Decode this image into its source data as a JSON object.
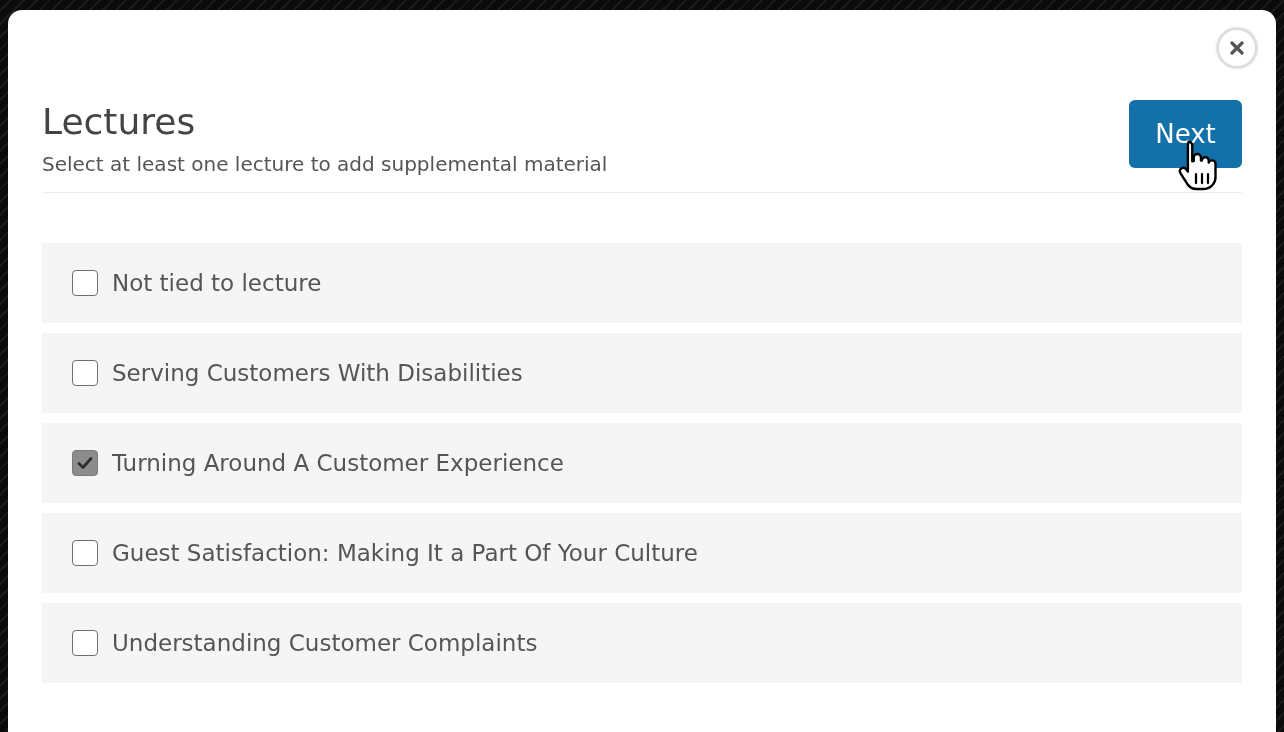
{
  "dialog": {
    "title": "Lectures",
    "subtitle": "Select at least one lecture to add supplemental material",
    "next_button": {
      "label": "Next"
    }
  },
  "lectures": [
    {
      "label": "Not tied to lecture",
      "checked": false
    },
    {
      "label": "Serving Customers With Disabilities",
      "checked": false
    },
    {
      "label": "Turning Around A Customer Experience",
      "checked": true
    },
    {
      "label": "Guest Satisfaction: Making It a Part Of Your Culture",
      "checked": false
    },
    {
      "label": "Understanding Customer Complaints",
      "checked": false
    }
  ]
}
